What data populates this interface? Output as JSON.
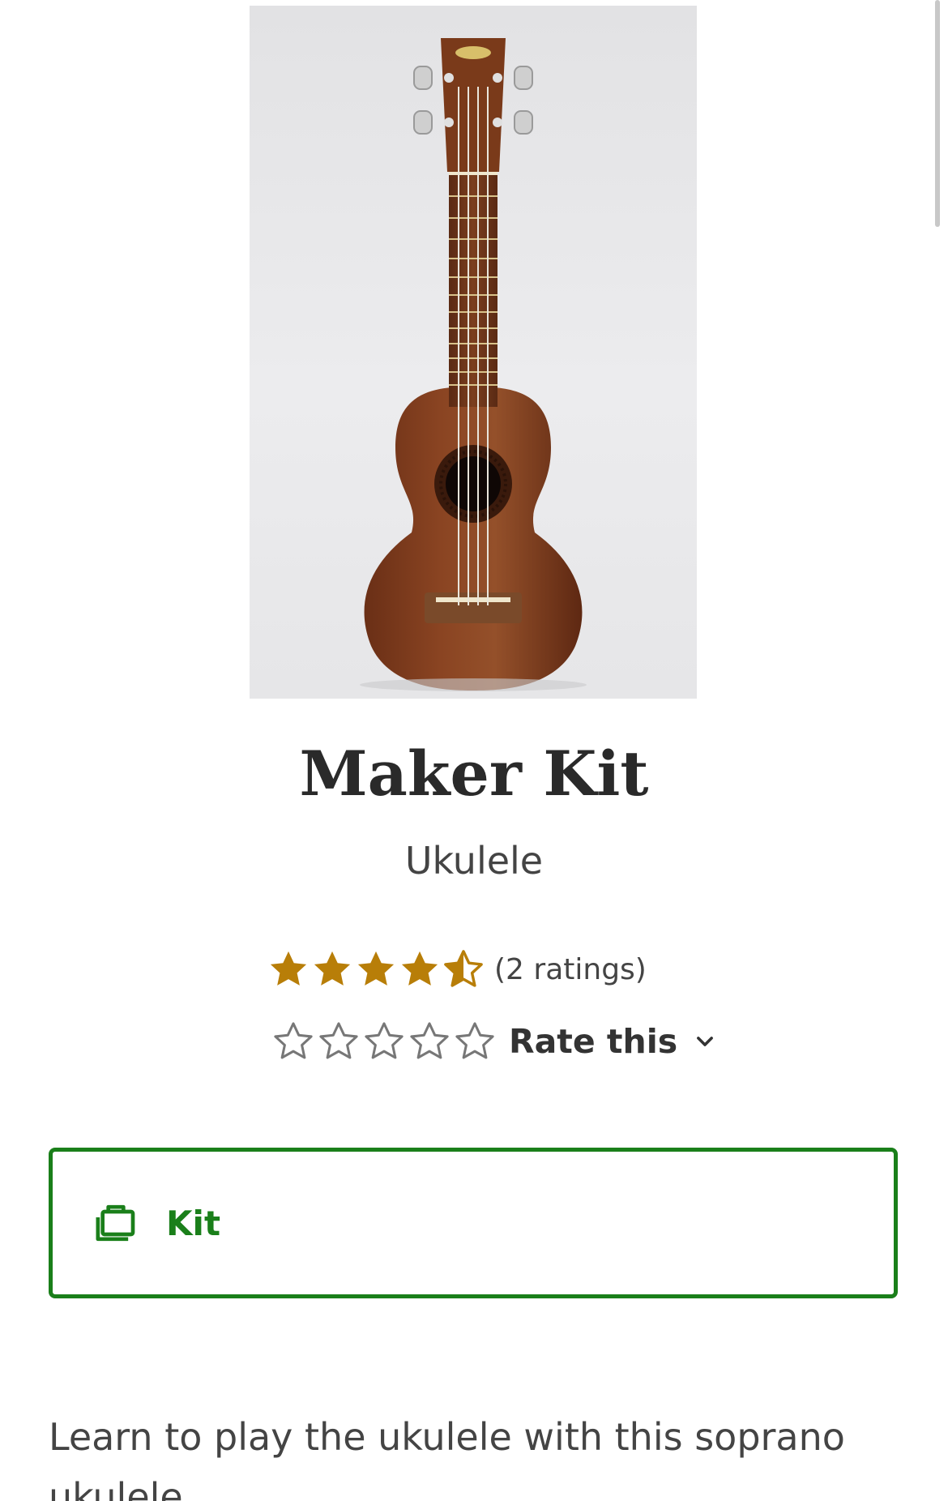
{
  "product": {
    "image_alt": "Kala soprano ukulele",
    "title": "Maker Kit",
    "subtitle": "Ukulele",
    "rating": {
      "value": 4.5,
      "max": 5,
      "count_label": "(2 ratings)",
      "star_color": "#b87e08"
    },
    "rate_this": {
      "label": "Rate this",
      "stars": 5
    },
    "format": {
      "label": "Kit",
      "icon": "kit-bag-icon",
      "accent_color": "#1a7f1a"
    },
    "description": "Learn to play the ukulele with this soprano ukulele."
  }
}
